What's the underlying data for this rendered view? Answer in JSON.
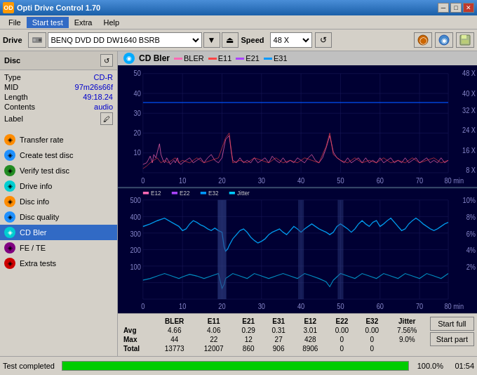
{
  "app": {
    "title": "Opti Drive Control 1.70",
    "icon": "OD"
  },
  "title_controls": {
    "minimize": "─",
    "maximize": "□",
    "close": "✕"
  },
  "menu": {
    "items": [
      "File",
      "Start test",
      "Extra",
      "Help"
    ]
  },
  "toolbar": {
    "drive_label": "Drive",
    "drive_value": "BENQ DVD DD DW1640 BSRB",
    "speed_label": "Speed",
    "speed_value": "48 X"
  },
  "disc": {
    "section_title": "Disc",
    "type_label": "Type",
    "type_value": "CD-R",
    "mid_label": "MID",
    "mid_value": "97m26s66f",
    "length_label": "Length",
    "length_value": "49:18.24",
    "contents_label": "Contents",
    "contents_value": "audio",
    "label_label": "Label"
  },
  "nav": {
    "items": [
      {
        "id": "transfer-rate",
        "label": "Transfer rate",
        "icon": "orange"
      },
      {
        "id": "create-test-disc",
        "label": "Create test disc",
        "icon": "blue"
      },
      {
        "id": "verify-test-disc",
        "label": "Verify test disc",
        "icon": "green"
      },
      {
        "id": "drive-info",
        "label": "Drive info",
        "icon": "cyan"
      },
      {
        "id": "disc-info",
        "label": "Disc info",
        "icon": "orange"
      },
      {
        "id": "disc-quality",
        "label": "Disc quality",
        "icon": "blue"
      },
      {
        "id": "cd-bler",
        "label": "CD Bler",
        "icon": "cyan",
        "active": true
      },
      {
        "id": "fe-te",
        "label": "FE / TE",
        "icon": "purple"
      },
      {
        "id": "extra-tests",
        "label": "Extra tests",
        "icon": "red"
      }
    ]
  },
  "chart": {
    "title": "CD Bler",
    "top_legend": [
      {
        "label": "BLER",
        "color": "#ff69b4"
      },
      {
        "label": "E11",
        "color": "#ff4444"
      },
      {
        "label": "E21",
        "color": "#aa44ff"
      },
      {
        "label": "E31",
        "color": "#0099ff"
      }
    ],
    "bottom_legend": [
      {
        "label": "E12",
        "color": "#ff69b4"
      },
      {
        "label": "E22",
        "color": "#aa44ff"
      },
      {
        "label": "E32",
        "color": "#0099ff"
      },
      {
        "label": "Jitter",
        "color": "#00ccff"
      }
    ],
    "top_y_labels": [
      "50",
      "40",
      "30",
      "20",
      "10"
    ],
    "top_y_right": [
      "48 X",
      "40 X",
      "32 X",
      "24 X",
      "16 X",
      "8 X"
    ],
    "bottom_y_labels": [
      "500",
      "400",
      "300",
      "200",
      "100"
    ],
    "bottom_y_right": [
      "10%",
      "8%",
      "6%",
      "4%",
      "2%"
    ],
    "x_labels": [
      "0",
      "10",
      "20",
      "30",
      "40",
      "50",
      "60",
      "70",
      "80 min"
    ]
  },
  "stats": {
    "headers": [
      "BLER",
      "E11",
      "E21",
      "E31",
      "E12",
      "E22",
      "E32",
      "Jitter"
    ],
    "rows": [
      {
        "label": "Avg",
        "values": [
          "4.66",
          "4.06",
          "0.29",
          "0.31",
          "3.01",
          "0.00",
          "0.00",
          "7.56%"
        ]
      },
      {
        "label": "Max",
        "values": [
          "44",
          "22",
          "12",
          "27",
          "428",
          "0",
          "0",
          "9.0%"
        ]
      },
      {
        "label": "Total",
        "values": [
          "13773",
          "12007",
          "860",
          "906",
          "8906",
          "0",
          "0",
          ""
        ]
      }
    ],
    "start_full": "Start full",
    "start_part": "Start part"
  },
  "status": {
    "text": "Test completed",
    "progress": "100.0%",
    "progress_value": 100,
    "time": "01:54"
  }
}
